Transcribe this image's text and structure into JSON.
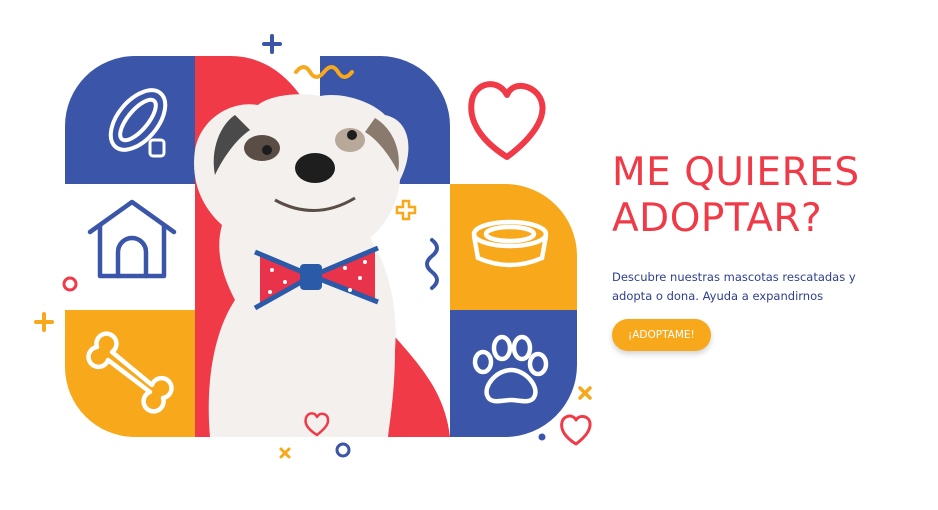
{
  "hero": {
    "title_line1": "ME QUIERES",
    "title_line2": "ADOPTAR?",
    "description": "Descubre nuestras mascotas rescatadas y adopta o dona. Ayuda a expandirnos",
    "button_label": "¡ADOPTAME!"
  },
  "colors": {
    "blue": "#3b55a8",
    "red": "#f03a47",
    "yellow": "#f7a81b",
    "white": "#ffffff",
    "text_blue": "#2f3f8f"
  },
  "icons": [
    "collar-icon",
    "doghouse-icon",
    "bone-icon",
    "bowl-icon",
    "paw-icon",
    "heart-icon",
    "plus-icon",
    "squiggle-icon",
    "circle-icon",
    "cross-icon"
  ]
}
